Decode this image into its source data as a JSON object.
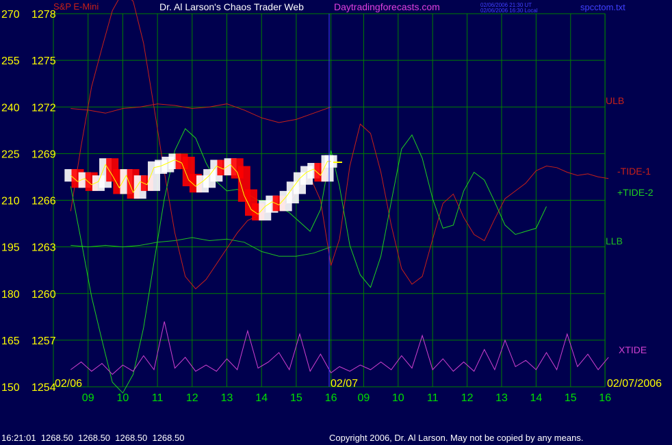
{
  "header": {
    "left_title": "S&P E-Mini",
    "title": "Dr. Al Larson's Chaos Trader Web",
    "site": "Daytradingforecasts.com",
    "time_ut": "02/06/2006 21:30 UT",
    "time_local": "02/06/2006 16:30 Local",
    "file": "spcctom.txt"
  },
  "footer": {
    "quote": "16:21:01  1268.50  1268.50  1268.50  1268.50",
    "copyright": "Copyright 2006, Dr. Al Larson. May not be copied by any means."
  },
  "colors": {
    "background": "#00004e",
    "grid": "#008000",
    "price_up": "#ffffff",
    "price_down": "#ff0000",
    "tide1": "#c82018",
    "tide2": "#20d020",
    "xtide": "#d040d0",
    "bands_ulb": "#c82018",
    "bands_llb": "#20c020",
    "divider": "#4040ff",
    "ma": "#ffff00"
  },
  "chart_data": {
    "type": "line",
    "title": "",
    "y_left_outer": [
      "270",
      "255",
      "240",
      "225",
      "210",
      "195",
      "180",
      "165",
      "150"
    ],
    "y_left_inner": [
      "1278",
      "1275",
      "1272",
      "1269",
      "1266",
      "1263",
      "1260",
      "1257",
      "1254"
    ],
    "ylim_price": [
      1254,
      1278
    ],
    "x_hours_day1": [
      "09",
      "10",
      "11",
      "12",
      "13",
      "14",
      "15",
      "16"
    ],
    "x_hours_day2": [
      "09",
      "10",
      "11",
      "12",
      "13",
      "14",
      "15",
      "16"
    ],
    "x_date_day1": "02/06",
    "x_date_day2": "02/07",
    "x_date_right": "02/07/2006",
    "grid": true,
    "series_labels": {
      "ulb": "ULB",
      "tide1": "-TIDE-1",
      "tide2": "+TIDE-2",
      "llb": "LLB",
      "xtide": "XTIDE"
    },
    "series": [
      {
        "name": "price",
        "x_hours": [
          8.5,
          8.7,
          8.9,
          9.1,
          9.3,
          9.5,
          9.7,
          9.9,
          10.1,
          10.3,
          10.5,
          10.7,
          10.9,
          11.1,
          11.3,
          11.5,
          11.7,
          11.9,
          12.1,
          12.3,
          12.5,
          12.7,
          12.9,
          13.1,
          13.3,
          13.5,
          13.7,
          13.9,
          14.1,
          14.3,
          14.5,
          14.7,
          14.9,
          15.1,
          15.3,
          15.5,
          15.7,
          15.9,
          16.0
        ],
        "values": [
          1267.6,
          1267.2,
          1267.4,
          1267.0,
          1267.2,
          1268.3,
          1267.6,
          1266.8,
          1267.6,
          1266.5,
          1267.2,
          1267.0,
          1268.1,
          1268.2,
          1268.4,
          1268.6,
          1268.4,
          1267.3,
          1266.9,
          1267.2,
          1267.6,
          1268.2,
          1268.0,
          1268.3,
          1267.8,
          1266.3,
          1265.4,
          1265.1,
          1265.6,
          1265.9,
          1265.7,
          1266.2,
          1266.8,
          1267.4,
          1267.8,
          1268.0,
          1267.6,
          1268.5,
          1268.5
        ]
      },
      {
        "name": "ULB",
        "x_hours": [
          8.5,
          9.0,
          9.5,
          10.0,
          10.5,
          11.0,
          11.5,
          12.0,
          12.5,
          13.0,
          13.5,
          14.0,
          14.5,
          15.0,
          15.5,
          16.0
        ],
        "values": [
          1271.9,
          1271.8,
          1271.6,
          1271.9,
          1272.0,
          1272.2,
          1272.1,
          1271.9,
          1272.0,
          1272.2,
          1271.8,
          1271.3,
          1271.0,
          1271.2,
          1271.6,
          1272.0
        ]
      },
      {
        "name": "LLB",
        "x_hours": [
          8.5,
          9.0,
          9.5,
          10.0,
          10.5,
          11.0,
          11.5,
          12.0,
          12.5,
          13.0,
          13.5,
          14.0,
          14.5,
          15.0,
          15.5,
          16.0
        ],
        "values": [
          1263.1,
          1263.0,
          1263.1,
          1263.0,
          1263.1,
          1263.3,
          1263.4,
          1263.6,
          1263.4,
          1263.5,
          1263.3,
          1262.7,
          1262.4,
          1262.4,
          1262.6,
          1263.0
        ]
      },
      {
        "name": "-TIDE-1",
        "x_hours": [
          8.5,
          8.8,
          9.1,
          9.4,
          9.7,
          10.0,
          10.3,
          10.6,
          10.9,
          11.2,
          11.5,
          11.8,
          12.1,
          12.4,
          12.7,
          13.0,
          13.3,
          13.6,
          13.9,
          14.2,
          14.5,
          14.8,
          15.1,
          15.4,
          15.7,
          16.0,
          16.3,
          16.6,
          16.9,
          17.2,
          17.5,
          17.8,
          18.1,
          18.4,
          18.7,
          19.0,
          19.3,
          19.6,
          19.9,
          20.2,
          20.5,
          20.8,
          21.1,
          21.4,
          21.7,
          22.0,
          22.3,
          22.6,
          22.9,
          23.2,
          23.5,
          23.8,
          24.1
        ],
        "values": [
          1265.3,
          1269.5,
          1273.3,
          1275.8,
          1278.2,
          1279.4,
          1278.8,
          1276.1,
          1272.0,
          1267.8,
          1263.9,
          1261.1,
          1260.3,
          1260.9,
          1261.9,
          1262.9,
          1263.9,
          1264.7,
          1265.0,
          1265.3,
          1265.5,
          1265.9,
          1266.8,
          1267.5,
          1266.0,
          1261.8,
          1263.5,
          1268.2,
          1270.9,
          1270.3,
          1267.8,
          1264.4,
          1261.6,
          1260.6,
          1261.1,
          1263.5,
          1265.8,
          1266.4,
          1264.9,
          1263.8,
          1263.4,
          1264.8,
          1266.1,
          1266.6,
          1267.1,
          1267.9,
          1268.2,
          1268.1,
          1267.8,
          1267.6,
          1267.7,
          1267.5,
          1267.4
        ]
      },
      {
        "name": "+TIDE-2",
        "x_hours": [
          8.5,
          8.8,
          9.1,
          9.4,
          9.7,
          10.0,
          10.3,
          10.6,
          10.9,
          11.2,
          11.5,
          11.8,
          12.1,
          12.4,
          12.7,
          13.0,
          13.3,
          13.6,
          13.9,
          14.2,
          14.5,
          14.8,
          15.1,
          15.4,
          15.7,
          16.0,
          16.3,
          16.6,
          16.9,
          17.2,
          17.5,
          17.8,
          18.1,
          18.4,
          18.7,
          19.0,
          19.3,
          19.6,
          19.9,
          20.2,
          20.5,
          20.8,
          21.1,
          21.4,
          21.7,
          22.0,
          22.3,
          22.6,
          22.9,
          23.2,
          23.5,
          23.8,
          24.1
        ],
        "values": [
          1266.9,
          1263.4,
          1259.8,
          1257.0,
          1254.3,
          1253.6,
          1254.8,
          1257.8,
          1262.0,
          1266.1,
          1269.2,
          1270.6,
          1270.0,
          1268.4,
          1267.2,
          1266.6,
          1266.7,
          1266.4,
          1266.0,
          1265.9,
          1265.6,
          1265.2,
          1264.6,
          1264.0,
          1265.4,
          1269.2,
          1266.9,
          1263.1,
          1261.2,
          1260.4,
          1262.4,
          1265.9,
          1269.3,
          1270.2,
          1268.7,
          1266.1,
          1264.2,
          1264.4,
          1266.6,
          1267.8,
          1267.3,
          1265.9,
          1264.4,
          1263.8,
          1264.0,
          1264.2,
          1265.6
        ]
      },
      {
        "name": "XTIDE",
        "x_hours": [
          8.5,
          8.8,
          9.1,
          9.4,
          9.7,
          10.0,
          10.3,
          10.6,
          10.9,
          11.2,
          11.5,
          11.8,
          12.1,
          12.4,
          12.7,
          13.0,
          13.3,
          13.6,
          13.9,
          14.2,
          14.5,
          14.8,
          15.1,
          15.4,
          15.7,
          16.0,
          16.3,
          16.6,
          16.9,
          17.2,
          17.5,
          17.8,
          18.1,
          18.4,
          18.7,
          19.0,
          19.3,
          19.6,
          19.9,
          20.2,
          20.5,
          20.8,
          21.1,
          21.4,
          21.7,
          22.0,
          22.3,
          22.6,
          22.9,
          23.2,
          23.5,
          23.8,
          24.1
        ],
        "values": [
          1255.1,
          1255.6,
          1255.0,
          1255.5,
          1254.8,
          1255.4,
          1255.0,
          1256.0,
          1255.1,
          1258.2,
          1255.2,
          1255.9,
          1255.0,
          1255.4,
          1255.0,
          1255.8,
          1255.1,
          1257.6,
          1255.2,
          1255.6,
          1256.2,
          1255.1,
          1257.4,
          1255.0,
          1256.1,
          1254.9,
          1255.3,
          1255.0,
          1255.4,
          1255.1,
          1255.6,
          1255.1,
          1256.0,
          1255.2,
          1257.3,
          1255.1,
          1255.8,
          1255.0,
          1255.6,
          1255.0,
          1256.4,
          1255.1,
          1257.0,
          1255.3,
          1255.7,
          1255.1,
          1256.2,
          1255.1,
          1257.4,
          1255.3,
          1256.1,
          1255.1,
          1255.9
        ]
      }
    ]
  }
}
